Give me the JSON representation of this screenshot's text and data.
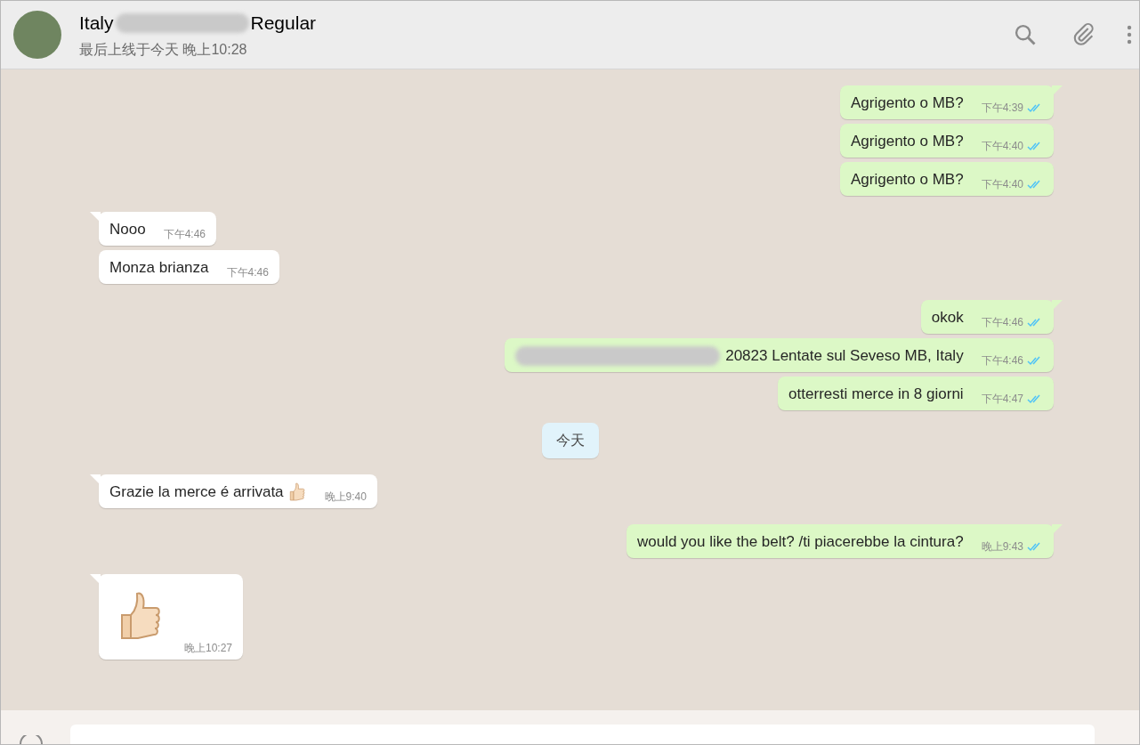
{
  "header": {
    "title_start": "Italy",
    "title_end": "Regular",
    "title_redacted": true,
    "status": "最后上线于今天 晚上10:28"
  },
  "messages": [
    {
      "kind": "out",
      "text": "Agrigento o MB?",
      "time": "下午4:39",
      "read": true,
      "tail": true
    },
    {
      "kind": "out",
      "text": "Agrigento o MB?",
      "time": "下午4:40",
      "read": true,
      "tail": false
    },
    {
      "kind": "out",
      "text": "Agrigento o MB?",
      "time": "下午4:40",
      "read": true,
      "tail": false
    },
    {
      "kind": "in",
      "text": "Nooo",
      "time": "下午4:46",
      "tail": true
    },
    {
      "kind": "in",
      "text": "Monza brianza",
      "time": "下午4:46",
      "tail": false
    },
    {
      "kind": "out",
      "text": "okok",
      "time": "下午4:46",
      "read": true,
      "tail": true
    },
    {
      "kind": "out",
      "text": "20823 Lentate sul Seveso MB, Italy",
      "time": "下午4:46",
      "read": true,
      "tail": false,
      "redacted_prefix": true
    },
    {
      "kind": "out",
      "text": "otterresti merce in 8 giorni",
      "time": "下午4:47",
      "read": true,
      "tail": false
    },
    {
      "kind": "date",
      "text": "今天"
    },
    {
      "kind": "in",
      "text": "Grazie la merce é arrivata",
      "time": "晚上9:40",
      "tail": true,
      "trailing_emoji": true
    },
    {
      "kind": "out",
      "text": "would you like the belt? /ti piacerebbe la cintura?",
      "time": "晚上9:43",
      "read": true,
      "tail": true
    },
    {
      "kind": "sticker",
      "time": "晚上10:27",
      "tail": true
    }
  ]
}
